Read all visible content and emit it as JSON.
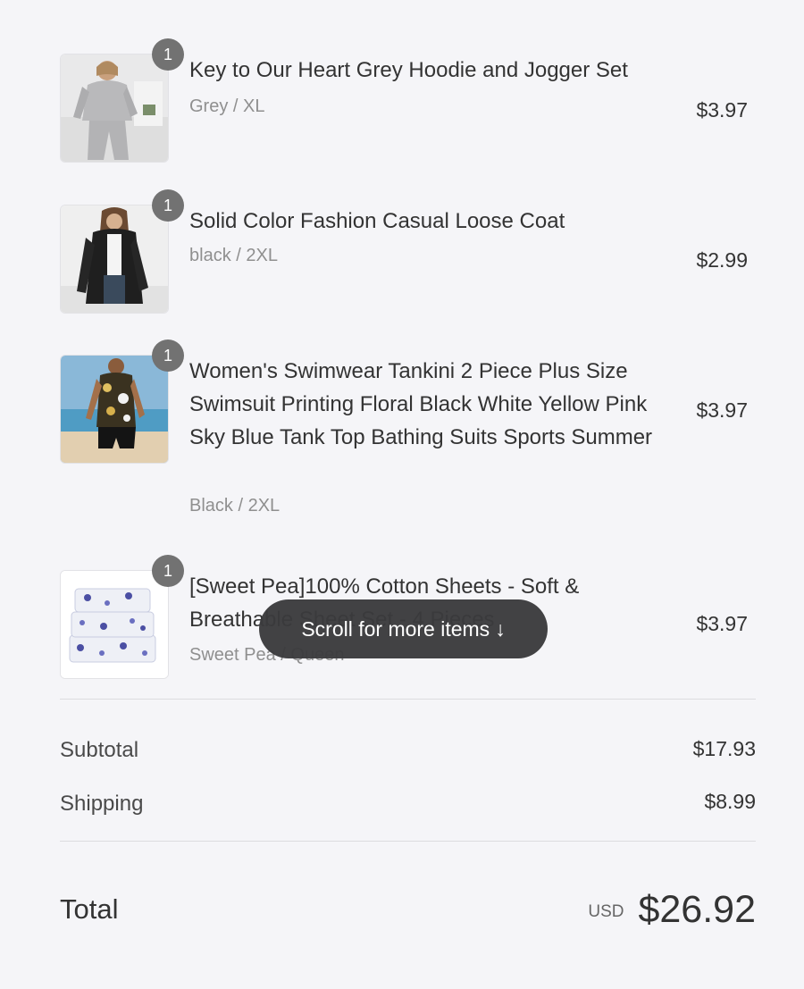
{
  "items": [
    {
      "qty": "1",
      "name": "Key to Our Heart Grey Hoodie and Jogger Set",
      "variant": "Grey / XL",
      "price": "$3.97"
    },
    {
      "qty": "1",
      "name": "Solid Color Fashion Casual Loose Coat",
      "variant": "black / 2XL",
      "price": "$2.99"
    },
    {
      "qty": "1",
      "name": "Women's Swimwear Tankini 2 Piece Plus Size Swimsuit Printing Floral Black White Yellow Pink Sky Blue Tank Top Bathing Suits Sports Summer",
      "variant": "Black / 2XL",
      "price": "$3.97"
    },
    {
      "qty": "1",
      "name": "[Sweet Pea]100% Cotton Sheets - Soft & Breathable Sheet Set - 4 Pieces",
      "variant": "Sweet Pea / Queen",
      "price": "$3.97"
    }
  ],
  "subtotal": {
    "label": "Subtotal",
    "value": "$17.93"
  },
  "shipping": {
    "label": "Shipping",
    "value": "$8.99"
  },
  "total": {
    "label": "Total",
    "currency": "USD",
    "value": "$26.92"
  },
  "scroll_hint": {
    "label": "Scroll for more items",
    "arrow": "↓"
  }
}
